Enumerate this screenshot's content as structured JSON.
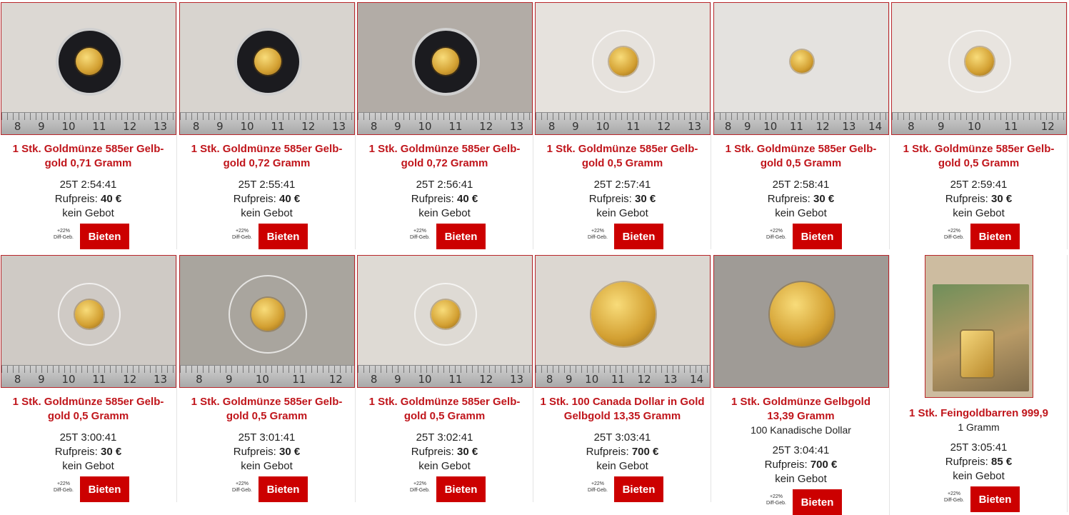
{
  "colors": {
    "accent": "#cc0000",
    "title": "#c0151b",
    "frame": "#b9262a"
  },
  "bid_button_label": "Bieten",
  "diff_line1": "+22%",
  "diff_line2": "Diff-Geb.",
  "price_label": "Rufpreis:",
  "items": [
    {
      "title": "1 Stk. Goldmünze 585er Gelb-gold 0,71 Gramm",
      "time": "25T 2:54:41",
      "price": "40 €",
      "bid_status": "kein Gebot",
      "image": "coin-in-black-capsule",
      "ruler": [
        "8",
        "9",
        "10",
        "11",
        "12",
        "13"
      ]
    },
    {
      "title": "1 Stk. Goldmünze 585er Gelb-gold 0,72 Gramm",
      "time": "25T 2:55:41",
      "price": "40 €",
      "bid_status": "kein Gebot",
      "image": "coin-in-black-capsule",
      "ruler": [
        "8",
        "9",
        "10",
        "11",
        "12",
        "13"
      ]
    },
    {
      "title": "1 Stk. Goldmünze 585er Gelb-gold 0,72 Gramm",
      "time": "25T 2:56:41",
      "price": "40 €",
      "bid_status": "kein Gebot",
      "image": "coin-in-black-capsule",
      "ruler": [
        "8",
        "9",
        "10",
        "11",
        "12",
        "13"
      ]
    },
    {
      "title": "1 Stk. Goldmünze 585er Gelb-gold 0,5 Gramm",
      "time": "25T 2:57:41",
      "price": "30 €",
      "bid_status": "kein Gebot",
      "image": "coin-in-clear-capsule",
      "ruler": [
        "8",
        "9",
        "10",
        "11",
        "12",
        "13"
      ]
    },
    {
      "title": "1 Stk. Goldmünze 585er Gelb-gold 0,5 Gramm",
      "time": "25T 2:58:41",
      "price": "30 €",
      "bid_status": "kein Gebot",
      "image": "coin-in-plastic-bag",
      "ruler": [
        "8",
        "9",
        "10",
        "11",
        "12",
        "13",
        "14"
      ]
    },
    {
      "title": "1 Stk. Goldmünze 585er Gelb-gold 0,5 Gramm",
      "time": "25T 2:59:41",
      "price": "30 €",
      "bid_status": "kein Gebot",
      "image": "coin-in-clear-capsule",
      "ruler": [
        "8",
        "9",
        "10",
        "11",
        "12"
      ]
    },
    {
      "title": "1 Stk. Goldmünze 585er Gelb-gold 0,5 Gramm",
      "time": "25T 3:00:41",
      "price": "30 €",
      "bid_status": "kein Gebot",
      "image": "coin-in-clear-capsule",
      "ruler": [
        "8",
        "9",
        "10",
        "11",
        "12",
        "13"
      ]
    },
    {
      "title": "1 Stk. Goldmünze 585er Gelb-gold 0,5 Gramm",
      "time": "25T 3:01:41",
      "price": "30 €",
      "bid_status": "kein Gebot",
      "image": "coin-in-clear-capsule",
      "ruler": [
        "8",
        "9",
        "10",
        "11",
        "12"
      ]
    },
    {
      "title": "1 Stk. Goldmünze 585er Gelb-gold 0,5 Gramm",
      "time": "25T 3:02:41",
      "price": "30 €",
      "bid_status": "kein Gebot",
      "image": "coin-in-clear-capsule",
      "ruler": [
        "8",
        "9",
        "10",
        "11",
        "12",
        "13"
      ]
    },
    {
      "title": "1 Stk. 100 Canada Dollar in Gold Gelbgold 13,35 Gramm",
      "time": "25T 3:03:41",
      "price": "700 €",
      "bid_status": "kein Gebot",
      "image": "large-gold-coin",
      "ruler": [
        "8",
        "9",
        "10",
        "11",
        "12",
        "13",
        "14"
      ]
    },
    {
      "title": "1 Stk. Goldmünze Gelbgold 13,39 Gramm",
      "subtitle": "100 Kanadische Dollar",
      "time": "25T 3:04:41",
      "price": "700 €",
      "bid_status": "kein Gebot",
      "image": "large-gold-coin"
    },
    {
      "title": "1 Stk. Feingoldbarren 999,9",
      "subtitle": "1 Gramm",
      "time": "25T 3:05:41",
      "price": "85 €",
      "bid_status": "kein Gebot",
      "image": "gold-bar-card"
    }
  ]
}
